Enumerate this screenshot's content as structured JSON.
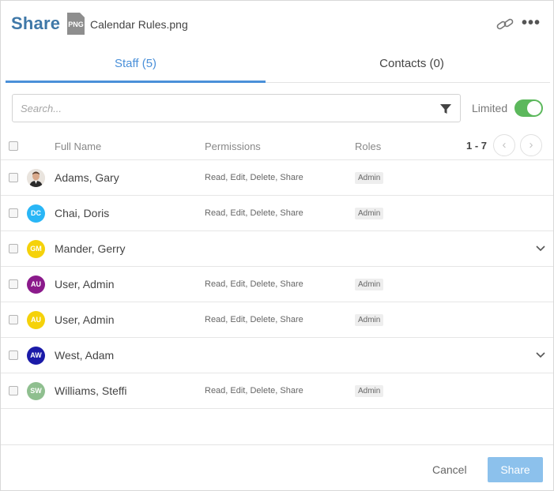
{
  "header": {
    "title": "Share",
    "file_type": "PNG",
    "file_name": "Calendar Rules.png",
    "more_label": "•••",
    "icons": {
      "link": "link-icon",
      "more": "more-horizontal-icon"
    }
  },
  "tabs": [
    {
      "label": "Staff (5)",
      "active": true
    },
    {
      "label": "Contacts (0)",
      "active": false
    }
  ],
  "search": {
    "placeholder": "Search...",
    "value": ""
  },
  "limited": {
    "label": "Limited",
    "on": true
  },
  "table": {
    "columns": [
      "Full Name",
      "Permissions",
      "Roles"
    ],
    "pager": "1 - 7",
    "rows": [
      {
        "initials": "",
        "photo": true,
        "color": "#e8e2dc",
        "name": "Adams, Gary",
        "permissions": "Read, Edit, Delete, Share",
        "role": "Admin",
        "expandable": false
      },
      {
        "initials": "DC",
        "photo": false,
        "color": "#29b6f6",
        "name": "Chai, Doris",
        "permissions": "Read, Edit, Delete, Share",
        "role": "Admin",
        "expandable": false
      },
      {
        "initials": "GM",
        "photo": false,
        "color": "#f5d20a",
        "name": "Mander, Gerry",
        "permissions": "",
        "role": "",
        "expandable": true
      },
      {
        "initials": "AU",
        "photo": false,
        "color": "#8b1a8b",
        "name": "User, Admin",
        "permissions": "Read, Edit, Delete, Share",
        "role": "Admin",
        "expandable": false
      },
      {
        "initials": "AU",
        "photo": false,
        "color": "#f5d20a",
        "name": "User, Admin",
        "permissions": "Read, Edit, Delete, Share",
        "role": "Admin",
        "expandable": false
      },
      {
        "initials": "AW",
        "photo": false,
        "color": "#1a1aa8",
        "name": "West, Adam",
        "permissions": "",
        "role": "",
        "expandable": true
      },
      {
        "initials": "SW",
        "photo": false,
        "color": "#8fbf8f",
        "name": "Williams, Steffi",
        "permissions": "Read, Edit, Delete, Share",
        "role": "Admin",
        "expandable": false
      }
    ]
  },
  "footer": {
    "cancel_label": "Cancel",
    "share_label": "Share"
  },
  "colors": {
    "title": "#3f78a8",
    "accent": "#4a90d9",
    "toggle": "#5cb85c",
    "share_button": "#8cc1ec"
  }
}
